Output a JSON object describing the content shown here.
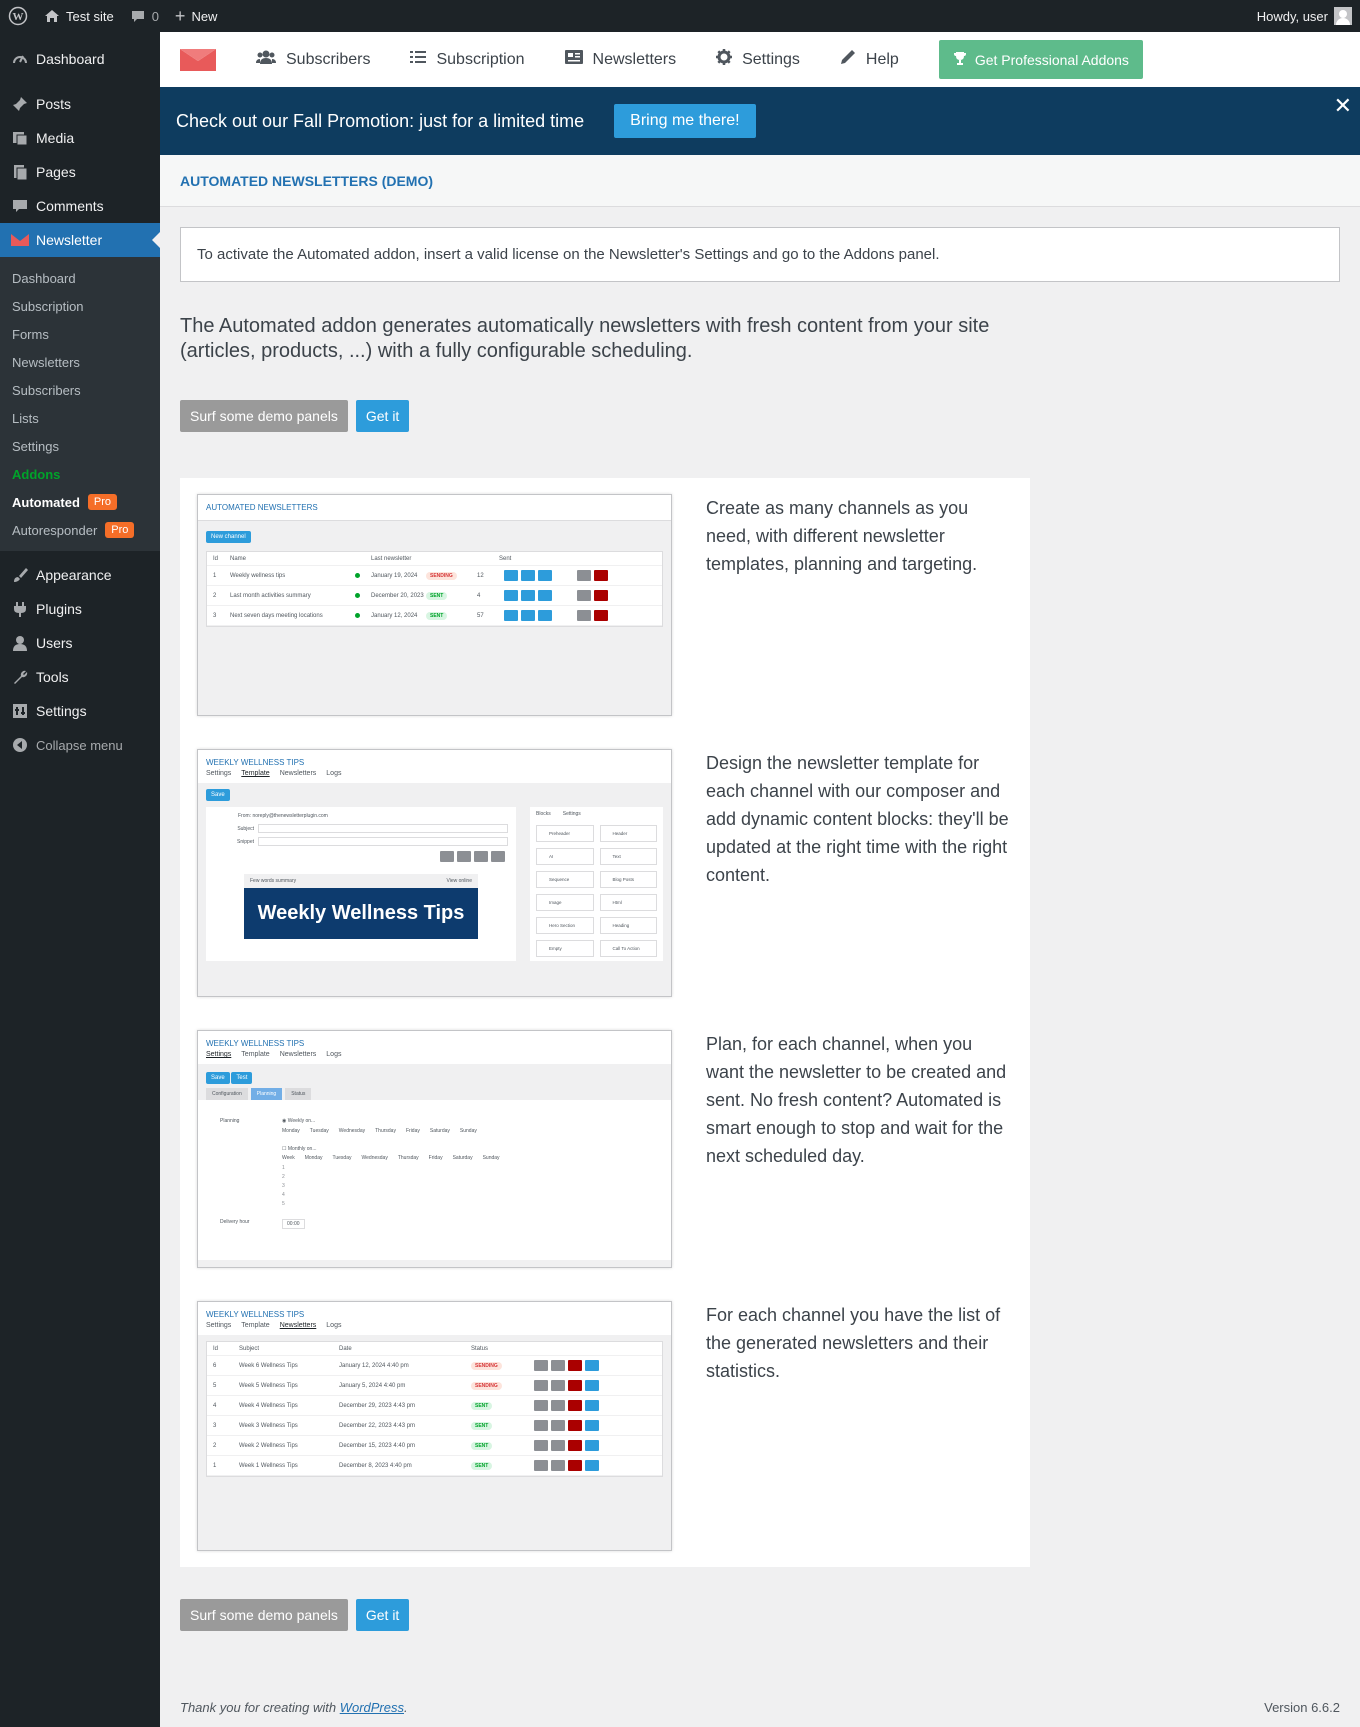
{
  "adminbar": {
    "site_name": "Test site",
    "comments_count": "0",
    "new_label": "New",
    "howdy": "Howdy, user"
  },
  "sidebar": {
    "top": [
      {
        "label": "Dashboard",
        "icon": "dashboard-icon"
      }
    ],
    "main": [
      {
        "label": "Posts",
        "icon": "pin-icon"
      },
      {
        "label": "Media",
        "icon": "media-icon"
      },
      {
        "label": "Pages",
        "icon": "pages-icon"
      },
      {
        "label": "Comments",
        "icon": "comment-icon"
      }
    ],
    "current": {
      "label": "Newsletter",
      "icon": "newsletter-icon"
    },
    "submenu": [
      {
        "label": "Dashboard"
      },
      {
        "label": "Subscription"
      },
      {
        "label": "Forms"
      },
      {
        "label": "Newsletters"
      },
      {
        "label": "Subscribers"
      },
      {
        "label": "Lists"
      },
      {
        "label": "Settings"
      },
      {
        "label": "Addons"
      },
      {
        "label": "Automated",
        "badge": "Pro"
      },
      {
        "label": "Autoresponder",
        "badge": "Pro"
      }
    ],
    "bottom": [
      {
        "label": "Appearance",
        "icon": "brush-icon"
      },
      {
        "label": "Plugins",
        "icon": "plug-icon"
      },
      {
        "label": "Users",
        "icon": "user-icon"
      },
      {
        "label": "Tools",
        "icon": "wrench-icon"
      },
      {
        "label": "Settings",
        "icon": "settings-icon"
      }
    ],
    "collapse": "Collapse menu"
  },
  "nav": {
    "subscribers": "Subscribers",
    "subscription": "Subscription",
    "newsletters": "Newsletters",
    "settings": "Settings",
    "help": "Help",
    "pro_button": "Get Professional Addons"
  },
  "promo": {
    "text": "Check out our Fall Promotion: just for a limited time",
    "button": "Bring me there!"
  },
  "page": {
    "title": "AUTOMATED NEWSLETTERS (DEMO)",
    "notice": "To activate the Automated addon, insert a valid license on the Newsletter's Settings and go to the Addons panel.",
    "lead": "The Automated addon generates automatically newsletters with fresh content from your site (articles, products, ...) with a fully configurable scheduling.",
    "btn_demo": "Surf some demo panels",
    "btn_get": "Get it"
  },
  "features": [
    {
      "text": "Create as many channels as you need, with different newsletter templates, planning and targeting."
    },
    {
      "text": "Design the newsletter template for each channel with our composer and add dynamic content blocks: they'll be updated at the right time with the right content."
    },
    {
      "text": "Plan, for each channel, when you want the newsletter to be created and sent. No fresh content? Automated is smart enough to stop and wait for the next scheduled day."
    },
    {
      "text": "For each channel you have the list of the generated newsletters and their statistics."
    }
  ],
  "shot1": {
    "title": "AUTOMATED NEWSLETTERS",
    "new_channel": "New channel",
    "cols": [
      "Id",
      "Name",
      "Last newsletter",
      "Sent"
    ],
    "rows": [
      {
        "id": "1",
        "name": "Weekly wellness tips",
        "date": "January 19, 2024",
        "status": "SENDING",
        "sent": "12"
      },
      {
        "id": "2",
        "name": "Last month activities summary",
        "date": "December 20, 2023",
        "status": "SENT",
        "sent": "4"
      },
      {
        "id": "3",
        "name": "Next seven days meeting locations",
        "date": "January 12, 2024",
        "status": "SENT",
        "sent": "57"
      }
    ]
  },
  "shot2": {
    "title": "WEEKLY WELLNESS TIPS",
    "tabs": [
      "Settings",
      "Template",
      "Newsletters",
      "Logs"
    ],
    "save": "Save",
    "from": "From: noreply@thenewsletterplugin.com",
    "subject": "Subject",
    "snippet": "Snippet",
    "summary": "Few words summary",
    "view_online": "View online",
    "hero": "Weekly Wellness Tips",
    "panel_tabs": [
      "Blocks",
      "Settings"
    ],
    "blocks": [
      "Preheader",
      "Header",
      "AI",
      "Text",
      "Sequence",
      "Blog Posts",
      "Image",
      "Html",
      "Hero Section",
      "Heading",
      "Empty",
      "Call To Action"
    ]
  },
  "shot3": {
    "title": "WEEKLY WELLNESS TIPS",
    "tabs": [
      "Settings",
      "Template",
      "Newsletters",
      "Logs"
    ],
    "save": "Save",
    "test": "Test",
    "subtabs": [
      "Configuration",
      "Planning",
      "Status"
    ],
    "planning": "Planning",
    "weekly": "Weekly on...",
    "days": [
      "Monday",
      "Tuesday",
      "Wednesday",
      "Thursday",
      "Friday",
      "Saturday",
      "Sunday"
    ],
    "monthly": "Monthly on...",
    "week": "Week",
    "delivery": "Delivery hour",
    "hour": "00:00"
  },
  "shot4": {
    "title": "WEEKLY WELLNESS TIPS",
    "tabs": [
      "Settings",
      "Template",
      "Newsletters",
      "Logs"
    ],
    "cols": [
      "Id",
      "Subject",
      "Date",
      "Status"
    ],
    "rows": [
      {
        "id": "6",
        "subject": "Week 6 Wellness Tips",
        "date": "January 12, 2024 4:40 pm",
        "status": "SENDING"
      },
      {
        "id": "5",
        "subject": "Week 5 Wellness Tips",
        "date": "January 5, 2024 4:40 pm",
        "status": "SENDING"
      },
      {
        "id": "4",
        "subject": "Week 4 Wellness Tips",
        "date": "December 29, 2023 4:43 pm",
        "status": "SENT"
      },
      {
        "id": "3",
        "subject": "Week 3 Wellness Tips",
        "date": "December 22, 2023 4:43 pm",
        "status": "SENT"
      },
      {
        "id": "2",
        "subject": "Week 2 Wellness Tips",
        "date": "December 15, 2023 4:40 pm",
        "status": "SENT"
      },
      {
        "id": "1",
        "subject": "Week 1 Wellness Tips",
        "date": "December 8, 2023 4:40 pm",
        "status": "SENT"
      }
    ]
  },
  "footer": {
    "thanks": "Thank you for creating with ",
    "wp": "WordPress",
    "period": ".",
    "version": "Version 6.6.2"
  },
  "colors": {
    "sidebar": "#1d2327",
    "accent": "#2271b1",
    "promo": "#0e3c5f",
    "pro_badge": "#f56e28",
    "addons": "#00a32a"
  }
}
